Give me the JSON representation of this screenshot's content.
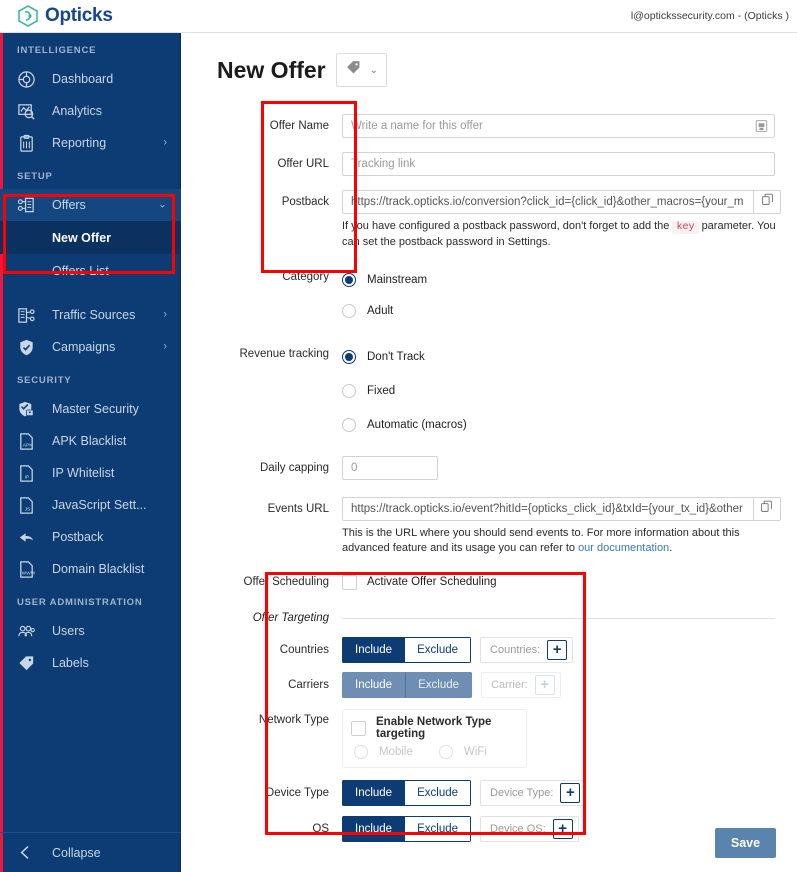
{
  "topbar": {
    "brand": "Opticks",
    "brand_icon": "hexagon-logo-icon",
    "account": "l@optickssecurity.com - (Opticks )"
  },
  "sidebar": {
    "sections": [
      {
        "label": "INTELLIGENCE",
        "items": [
          {
            "label": "Dashboard",
            "icon": "dashboard-pie-icon",
            "chevron": ""
          },
          {
            "label": "Analytics",
            "icon": "analytics-chart-icon",
            "chevron": ""
          },
          {
            "label": "Reporting",
            "icon": "reporting-clipboard-icon",
            "chevron": "›"
          }
        ]
      },
      {
        "label": "SETUP",
        "items": [
          {
            "label": "Offers",
            "icon": "offers-flow-icon",
            "chevron": "⌄"
          },
          {
            "label": "Traffic Sources",
            "icon": "traffic-sources-icon",
            "chevron": "›"
          },
          {
            "label": "Campaigns",
            "icon": "campaigns-shield-icon",
            "chevron": "›"
          }
        ],
        "subitems": [
          {
            "label": "New Offer",
            "current": true
          },
          {
            "label": "Offers List",
            "current": false
          }
        ]
      },
      {
        "label": "SECURITY",
        "items": [
          {
            "label": "Master Security",
            "icon": "master-security-shield-icon",
            "chevron": ""
          },
          {
            "label": "APK Blacklist",
            "icon": "apk-file-icon",
            "chevron": ""
          },
          {
            "label": "IP Whitelist",
            "icon": "ip-file-icon",
            "chevron": ""
          },
          {
            "label": "JavaScript Sett...",
            "icon": "js-file-icon",
            "chevron": ""
          },
          {
            "label": "Postback",
            "icon": "postback-arrow-icon",
            "chevron": ""
          },
          {
            "label": "Domain Blacklist",
            "icon": "www-file-icon",
            "chevron": ""
          }
        ]
      },
      {
        "label": "USER ADMINISTRATION",
        "items": [
          {
            "label": "Users",
            "icon": "users-group-icon",
            "chevron": ""
          },
          {
            "label": "Labels",
            "icon": "labels-tag-icon",
            "chevron": ""
          }
        ]
      }
    ],
    "collapse": {
      "label": "Collapse",
      "icon": "chevron-left-icon"
    }
  },
  "page": {
    "title": "New Offer",
    "tag_icon": "tag-icon",
    "tag_chevron": "⌄"
  },
  "form": {
    "offer_name": {
      "label": "Offer Name",
      "placeholder": "Write a name for this offer",
      "value": "",
      "addon_icon": "save-disk-icon"
    },
    "offer_url": {
      "label": "Offer URL",
      "placeholder": "Tracking link",
      "value": ""
    },
    "postback": {
      "label": "Postback",
      "value": "https://track.opticks.io/conversion?click_id={click_id}&other_macros={your_m",
      "copy_icon": "copy-icon",
      "helper_prefix": "If you have configured a postback password, don't forget to add the",
      "helper_chip": "key",
      "helper_suffix": "parameter. You can set the postback password in Settings."
    },
    "category": {
      "label": "Category",
      "options": [
        {
          "label": "Mainstream",
          "selected": true
        },
        {
          "label": "Adult",
          "selected": false
        }
      ]
    },
    "revenue_tracking": {
      "label": "Revenue tracking",
      "options": [
        {
          "label": "Don't Track",
          "selected": true
        },
        {
          "label": "Fixed",
          "selected": false
        },
        {
          "label": "Automatic (macros)",
          "selected": false
        }
      ]
    },
    "daily_capping": {
      "label": "Daily capping",
      "value": "0"
    },
    "events_url": {
      "label": "Events URL",
      "value": "https://track.opticks.io/event?hitId={opticks_click_id}&txId={your_tx_id}&other",
      "copy_icon": "copy-icon",
      "helper_prefix": "This is the URL where you should send events to. For more information about this advanced feature and its usage you can refer to",
      "helper_link": "our documentation",
      "helper_suffix": "."
    },
    "offer_scheduling": {
      "label": "Offer Scheduling",
      "checkbox_label": "Activate Offer Scheduling",
      "checked": false
    }
  },
  "targeting": {
    "section_title": "Offer Targeting",
    "include_label": "Include",
    "exclude_label": "Exclude",
    "plus_icon": "plus-icon",
    "rows": [
      {
        "label": "Countries",
        "selected": "Include",
        "disabled": false,
        "picker": "Countries:"
      },
      {
        "label": "Carriers",
        "selected": "Include",
        "disabled": true,
        "picker": "Carrier:"
      },
      {
        "label": "Device Type",
        "selected": "Include",
        "disabled": false,
        "picker": "Device Type:"
      },
      {
        "label": "OS",
        "selected": "Include",
        "disabled": false,
        "picker": "Device OS:"
      }
    ],
    "network_type": {
      "label": "Network Type",
      "enable_label": "Enable Network Type targeting",
      "enabled": false,
      "options": [
        {
          "label": "Mobile",
          "selected": false
        },
        {
          "label": "WiFi",
          "selected": false
        }
      ]
    }
  },
  "footer": {
    "save_label": "Save"
  },
  "colors": {
    "sidebar_bg": "#0d3c75",
    "brand_blue": "#17478a",
    "accent_red": "#e8193c",
    "highlight_red": "#ff0000",
    "save_blue": "#5a84ad",
    "link_blue": "#3a78b5",
    "chip_red": "#e0364f"
  }
}
